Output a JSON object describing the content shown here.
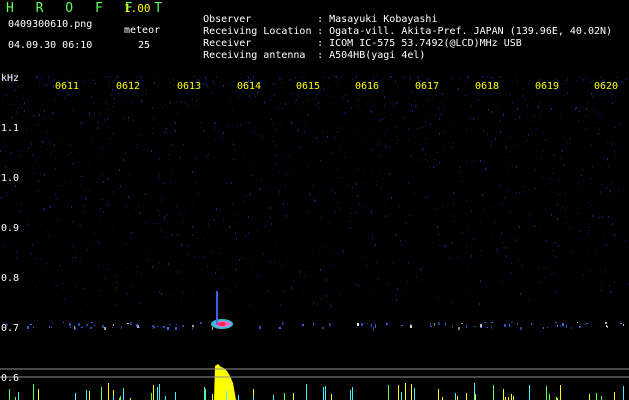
{
  "app": {
    "title": "H R O F F T",
    "version": "1.00",
    "filename": "0409300610.png",
    "datetime": "04.09.30 06:10",
    "meteor_label": "meteor",
    "meteor_count": "25"
  },
  "info": [
    {
      "label": "Observer",
      "value": "Masayuki Kobayashi"
    },
    {
      "label": "Receiving Location",
      "value": "Ogata-vill. Akita-Pref. JAPAN (139.96E, 40.02N)"
    },
    {
      "label": "Receiver",
      "value": "ICOM IC-575 53.7492(@LCD)MHz USB"
    },
    {
      "label": "Receiving antenna",
      "value": "A504HB(yagi 4el)"
    }
  ],
  "axis": {
    "y_unit": "kHz",
    "y_ticks": [
      "1.1",
      "1.0",
      "0.9",
      "0.8",
      "0.7",
      "0.6"
    ],
    "x_ticks": [
      "0611",
      "0612",
      "0613",
      "0614",
      "0615",
      "0616",
      "0617",
      "0618",
      "0619",
      "0620"
    ]
  },
  "colors": {
    "background": "#000000",
    "label_yellow": "#ffff00",
    "title_green": "#5cff5c",
    "noise_blue": "#1a2aa8",
    "signal_band": "#3a6cff",
    "meteor_red": "#ff2050",
    "meteor_pink": "#ff66cc",
    "meteor_cyan": "#3ff0ff",
    "meteor_yellow": "#ffff00",
    "baseline_grey": "#909090"
  }
}
